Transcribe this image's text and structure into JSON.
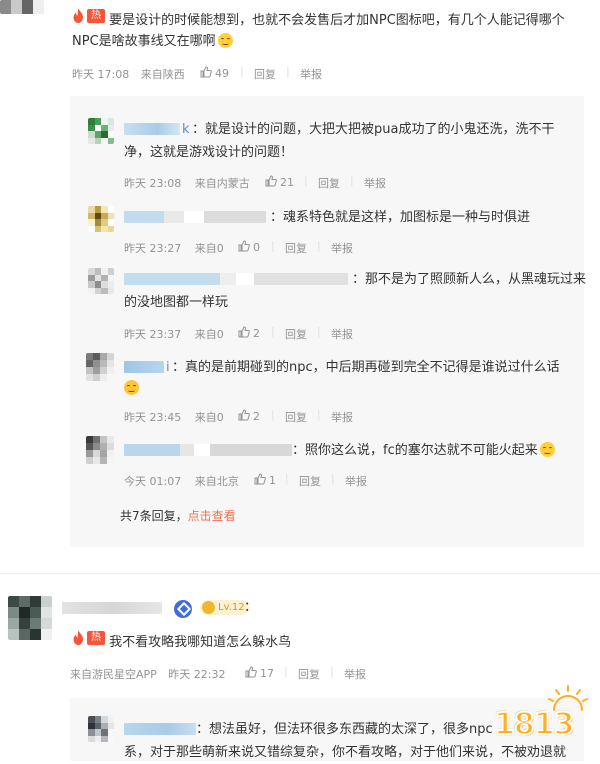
{
  "colors": {
    "hot": "#f5563a",
    "link": "#eb7350",
    "meta": "#939393",
    "reply_bg": "#f7f7f7"
  },
  "comment1": {
    "badge": "热",
    "text_line1": "要是设计的时候能想到，也就不会发售后才加NPC图标吧，有几个人能记得哪个",
    "text_line2": "NPC是啥故事线又在哪啊",
    "time": "昨天 17:08",
    "source": "来自陕西",
    "likes": "49",
    "reply": "回复",
    "report": "举报"
  },
  "replies": [
    {
      "name_suffix": "k",
      "text_line1": "：就是设计的问题，大把大把被pua成功了的小鬼还洗，洗不干",
      "text_line2": "净，这就是游戏设计的问题！",
      "time": "昨天 23:08",
      "source": "来自内蒙古",
      "likes": "21",
      "reply": "回复",
      "report": "举报"
    },
    {
      "text_line1": "：魂系特色就是这样，加图标是一种与时俱进",
      "time": "昨天 23:27",
      "source": "来自0",
      "likes": "0",
      "reply": "回复",
      "report": "举报"
    },
    {
      "text_line1": "：那不是为了照顾新人么，从黑魂玩过来",
      "text_line2": "的没地图都一样玩",
      "time": "昨天 23:37",
      "source": "来自0",
      "likes": "2",
      "reply": "回复",
      "report": "举报"
    },
    {
      "name_suffix": "i",
      "text_line1": "：真的是前期碰到的npc，中后期再碰到完全不记得是谁说过什么话",
      "time": "昨天 23:45",
      "source": "来自0",
      "likes": "2",
      "reply": "回复",
      "report": "举报"
    },
    {
      "text_line1": "：照你这么说，fc的塞尔达就不可能火起来",
      "time": "今天 01:07",
      "source": "来自北京",
      "likes": "1",
      "reply": "回复",
      "report": "举报"
    }
  ],
  "replies_summary": {
    "count_text": "共7条回复，",
    "view_link": "点击查看"
  },
  "comment2": {
    "level": "Lv.12",
    "colon": "：",
    "badge": "热",
    "text": "我不看攻略我哪知道怎么躲水鸟",
    "source": "来自游民星空APP",
    "time": "昨天 22:32",
    "likes": "17",
    "reply": "回复",
    "report": "举报"
  },
  "comment2_reply": {
    "text_line1": "：想法虽好，但法环很多东西藏的太深了，很多npc",
    "text_line2": "系，对于那些萌新来说又错综复杂，你不看攻略，对于他们来说，不被劝退就"
  },
  "watermark": {
    "text": "1813"
  },
  "icons": {
    "like": "thumbs-up-icon",
    "hot": "flame-icon",
    "vip": "verified-diamond-icon"
  }
}
